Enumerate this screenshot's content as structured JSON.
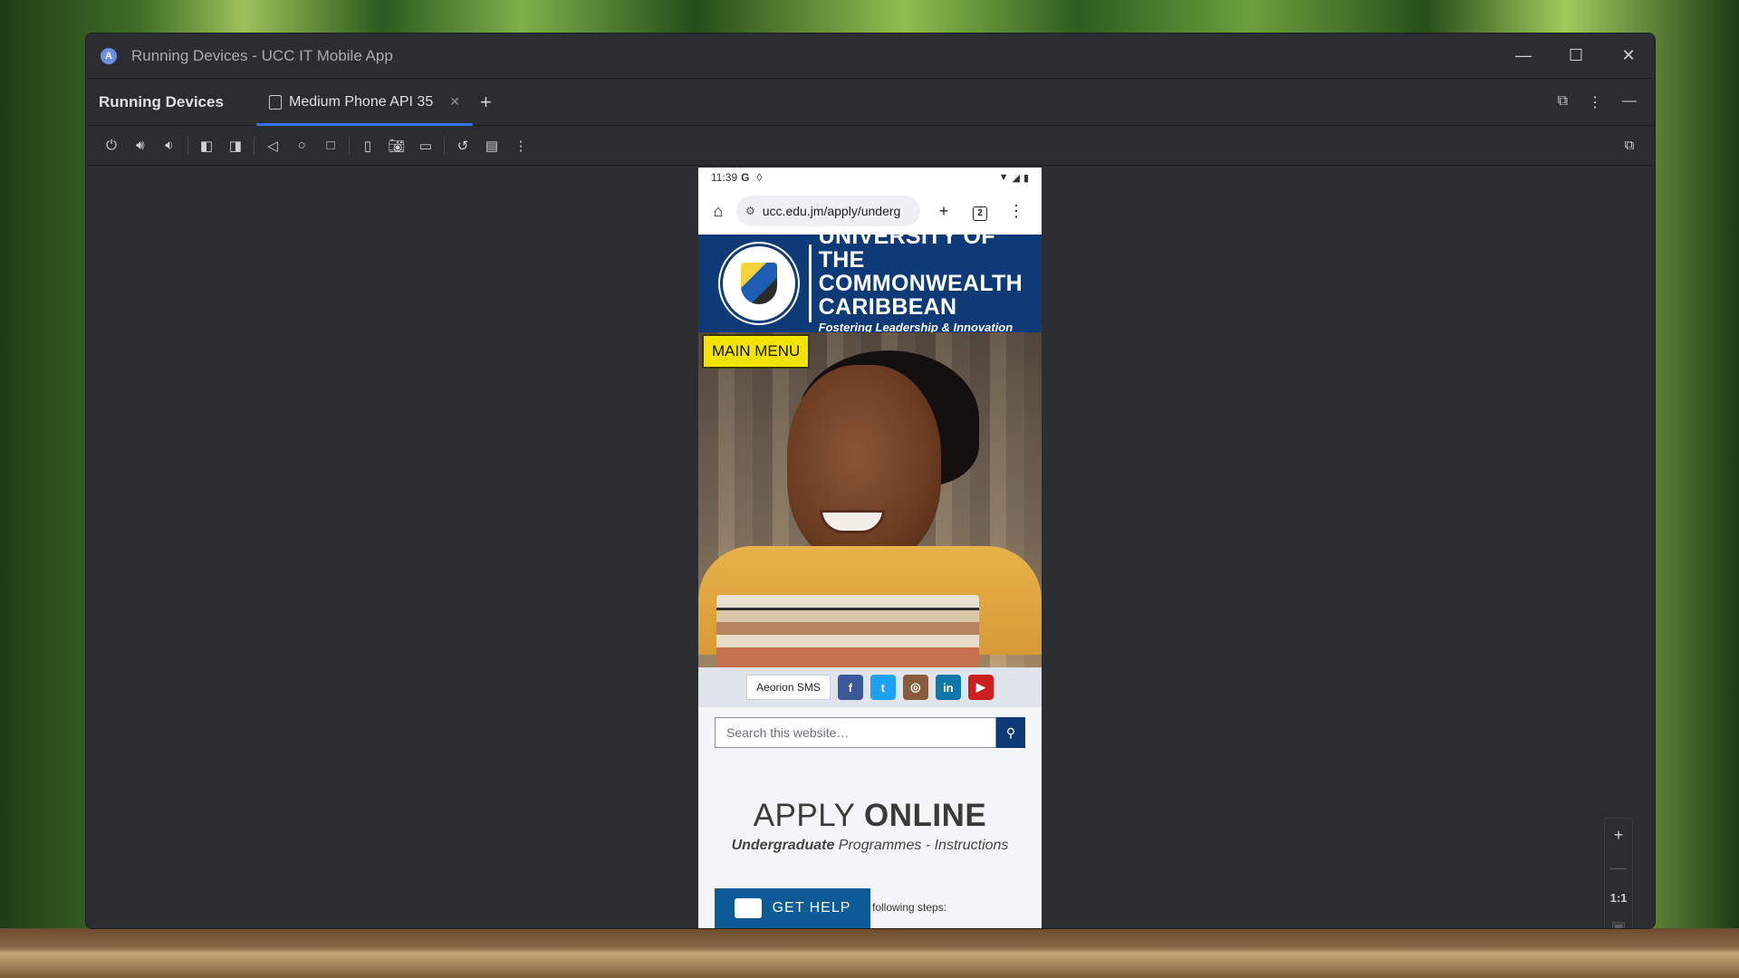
{
  "window": {
    "title": "Running Devices - UCC IT Mobile App",
    "app_icon": "A"
  },
  "tool_window": {
    "title": "Running Devices",
    "tabs": [
      {
        "label": "Medium Phone API 35",
        "active": true
      }
    ]
  },
  "phone": {
    "status": {
      "time": "11:39",
      "g_icon": "G"
    },
    "browser": {
      "url": "ucc.edu.jm/apply/underg",
      "tab_count": "2"
    },
    "site": {
      "name_line1": "UNIVERSITY OF THE",
      "name_line2": "COMMONWEALTH",
      "name_line3": "CARIBBEAN",
      "tagline": "Fostering Leadership & Innovation",
      "main_menu": "MAIN MENU",
      "aeorion": "Aeorion SMS",
      "search_placeholder": "Search this website…",
      "apply_light": "APPLY ",
      "apply_bold": "ONLINE",
      "sub_bold": "Undergraduate",
      "sub_rest": " Programmes - Instructions",
      "help": "GET HELP",
      "steps": "following steps:"
    },
    "social": [
      {
        "name": "facebook",
        "glyph": "f",
        "color": "#3b5998"
      },
      {
        "name": "twitter",
        "glyph": "t",
        "color": "#1da1f2"
      },
      {
        "name": "instagram",
        "glyph": "◎",
        "color": "#8a5a3c"
      },
      {
        "name": "linkedin",
        "glyph": "in",
        "color": "#0e76a8"
      },
      {
        "name": "youtube",
        "glyph": "▶",
        "color": "#cc1f1f"
      }
    ]
  },
  "zoom": {
    "ratio": "1:1"
  },
  "colors": {
    "accent": "#3574f0",
    "ucc_blue": "#0f3a78",
    "menu_yellow": "#f2e300"
  }
}
